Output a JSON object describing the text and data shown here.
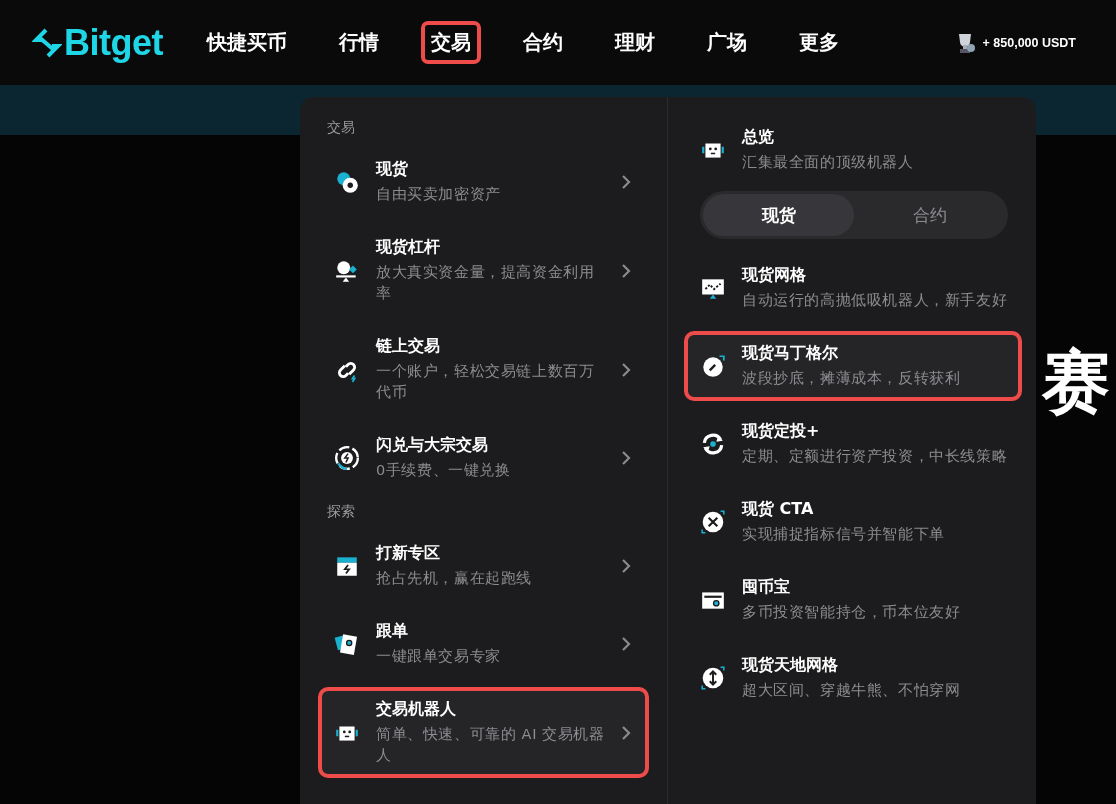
{
  "logo": "Bitget",
  "nav": [
    {
      "label": "快捷买币",
      "highlighted": false
    },
    {
      "label": "行情",
      "highlighted": false
    },
    {
      "label": "交易",
      "highlighted": true
    },
    {
      "label": "合约",
      "highlighted": false
    },
    {
      "label": "理财",
      "highlighted": false
    },
    {
      "label": "广场",
      "highlighted": false
    },
    {
      "label": "更多",
      "highlighted": false
    }
  ],
  "reward": "+ 850,000 USDT",
  "background_text": "赛",
  "menu": {
    "left": [
      {
        "heading": "交易",
        "items": [
          {
            "title": "现货",
            "description": "自由买卖加密资产",
            "highlighted": false
          },
          {
            "title": "现货杠杆",
            "description": "放大真实资金量，提高资金利用率",
            "highlighted": false
          },
          {
            "title": "链上交易",
            "description": "一个账户，轻松交易链上数百万代币",
            "highlighted": false
          },
          {
            "title": "闪兑与大宗交易",
            "description": "0手续费、一键兑换",
            "highlighted": false
          }
        ]
      },
      {
        "heading": "探索",
        "items": [
          {
            "title": "打新专区",
            "description": "抢占先机，赢在起跑线",
            "highlighted": false
          },
          {
            "title": "跟单",
            "description": "一键跟单交易专家",
            "highlighted": false
          },
          {
            "title": "交易机器人",
            "description": "简单、快速、可靠的 AI 交易机器人",
            "highlighted": true
          }
        ]
      }
    ],
    "right": {
      "overview": {
        "title": "总览",
        "description": "汇集最全面的顶级机器人"
      },
      "toggle": [
        {
          "label": "现货",
          "selected": true
        },
        {
          "label": "合约",
          "selected": false
        }
      ],
      "items": [
        {
          "title": "现货网格",
          "description": "自动运行的高抛低吸机器人，新手友好",
          "highlighted": false
        },
        {
          "title": "现货马丁格尔",
          "description": "波段抄底，摊薄成本，反转获利",
          "highlighted": true
        },
        {
          "title": "现货定投+",
          "description": "定期、定额进行资产投资，中长线策略",
          "highlighted": false
        },
        {
          "title": "现货 CTA",
          "description": "实现捕捉指标信号并智能下单",
          "highlighted": false
        },
        {
          "title": "囤币宝",
          "description": "多币投资智能持仓，币本位友好",
          "highlighted": false
        },
        {
          "title": "现货天地网格",
          "description": "超大区间、穿越牛熊、不怕穿网",
          "highlighted": false
        }
      ]
    }
  }
}
